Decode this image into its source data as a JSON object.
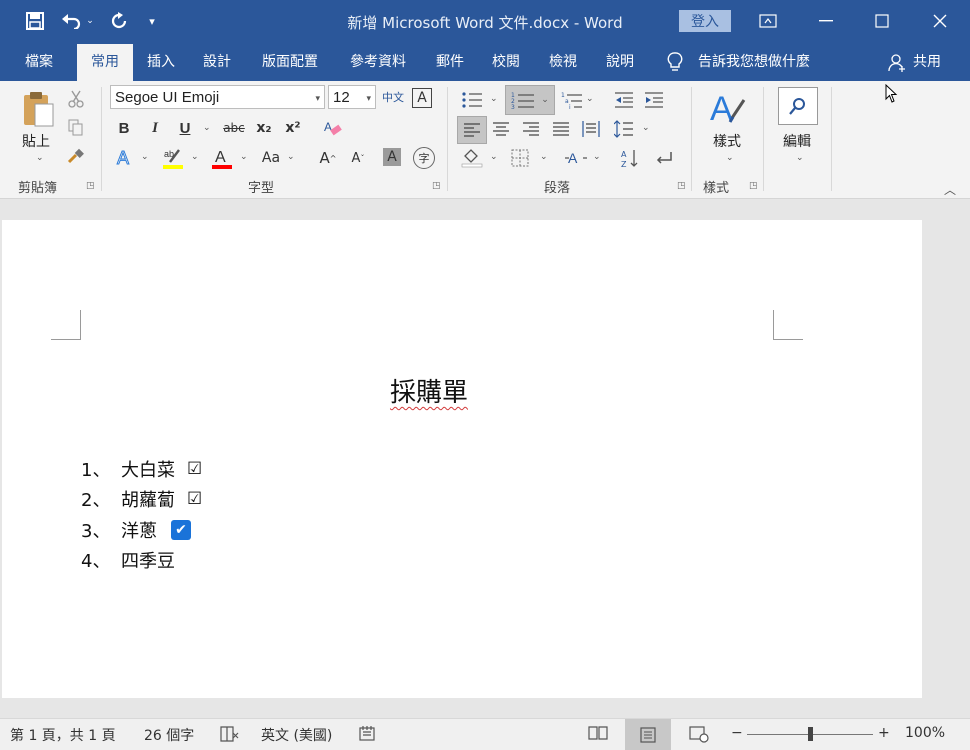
{
  "window": {
    "title": "新增 Microsoft Word 文件.docx  -  Word",
    "signin_label": "登入"
  },
  "tabs": [
    {
      "label": "檔案"
    },
    {
      "label": "常用"
    },
    {
      "label": "插入"
    },
    {
      "label": "設計"
    },
    {
      "label": "版面配置"
    },
    {
      "label": "參考資料"
    },
    {
      "label": "郵件"
    },
    {
      "label": "校閱"
    },
    {
      "label": "檢視"
    },
    {
      "label": "說明"
    }
  ],
  "tell_me": "告訴我您想做什麼",
  "share_label": "共用",
  "ribbon": {
    "clipboard": {
      "group_label": "剪貼簿",
      "paste_label": "貼上"
    },
    "font": {
      "group_label": "字型",
      "font_name": "Segoe UI Emoji",
      "font_size": "12",
      "bold": "B",
      "italic": "I",
      "underline": "U",
      "strike": "abc",
      "sub": "x₂",
      "sup": "x²",
      "change_case": "Aa",
      "grow": "A",
      "shrink": "A",
      "phonetic": "中文",
      "border_char": "A"
    },
    "paragraph": {
      "group_label": "段落"
    },
    "styles": {
      "group_label": "樣式",
      "button_label": "樣式"
    },
    "editing": {
      "button_label": "編輯"
    }
  },
  "document": {
    "heading": "採購單",
    "items": [
      {
        "number": "1、",
        "text": "大白菜",
        "check": "☑"
      },
      {
        "number": "2、",
        "text": "胡蘿蔔",
        "check": "☑"
      },
      {
        "number": "3、",
        "text": "洋蔥",
        "check": "✔"
      },
      {
        "number": "4、",
        "text": "四季豆",
        "check": ""
      }
    ]
  },
  "statusbar": {
    "page_info": "第 1 頁，共 1 頁",
    "word_count": "26 個字",
    "language": "英文 (美國)",
    "zoom": "100%"
  },
  "colors": {
    "accent": "#2b579a",
    "highlight": "#ffff00",
    "font_color": "#ff0000",
    "check_blue": "#1a73d9"
  }
}
